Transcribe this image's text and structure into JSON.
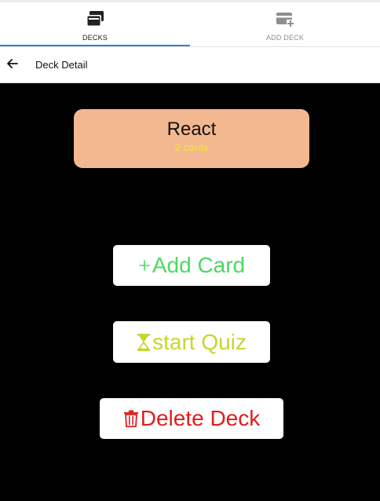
{
  "tabs": [
    {
      "label": "DECKS",
      "icon": "cards-stack-icon",
      "active": true
    },
    {
      "label": "ADD DECK",
      "icon": "add-card-icon",
      "active": false
    }
  ],
  "header": {
    "title": "Deck Detail",
    "back_icon": "arrow-left-icon"
  },
  "deck": {
    "name": "React",
    "count_label": "2 cards"
  },
  "actions": {
    "add_card": {
      "label": "Add Card",
      "icon": "plus-icon",
      "color": "#4cd964"
    },
    "start_quiz": {
      "label": "start Quiz",
      "icon": "hourglass-icon",
      "color": "#c6d62f"
    },
    "delete_deck": {
      "label": "Delete Deck",
      "icon": "trash-icon",
      "color": "#e11d1d"
    }
  },
  "colors": {
    "accent": "#2f80d1",
    "deck_card_bg": "#f3b88f",
    "deck_count": "#f5e53b",
    "background": "#000000"
  }
}
